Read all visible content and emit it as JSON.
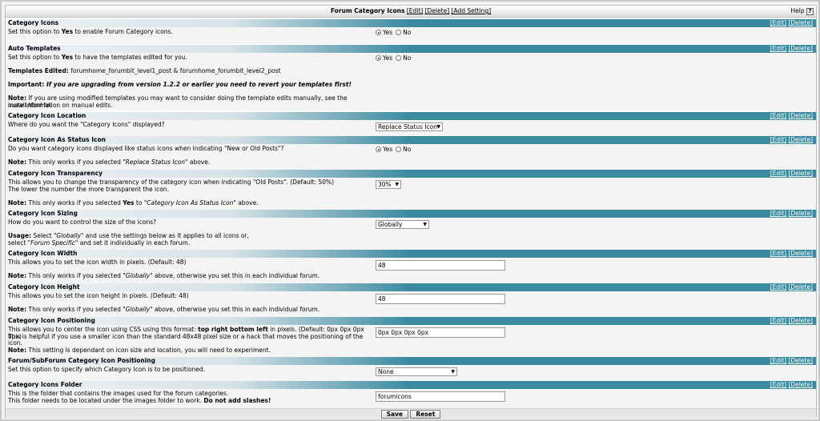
{
  "title": {
    "text": "Forum Category Icons",
    "edit": "[Edit]",
    "delete": "[Delete]",
    "add": "[Add Setting]",
    "help": "Help",
    "help_icon": "?"
  },
  "actions": {
    "edit": "[Edit]",
    "delete": "[Delete]"
  },
  "radio": {
    "yes": "Yes",
    "no": "No"
  },
  "sections": [
    {
      "title": "Category Icons",
      "lines": [
        "Set this option to <b>Yes</b> to enable Forum Category icons."
      ],
      "control": {
        "type": "radio",
        "selected": "yes"
      }
    },
    {
      "title": "Auto Templates",
      "lines": [
        "Set this option to <b>Yes</b> to have the templates edited for you.",
        "",
        "<b>Templates Edited:</b> forumhome_forumbit_level1_post &amp; forumhome_forumbit_level2_post",
        "",
        "<b>Important: <i>If you are upgrading from version 1.2.2 or earlier you need to revert your templates first!</i></b>",
        "",
        "<b>Note:</b> If you are using modified templates you may want to consider doing the template edits manually, see the <i>install.html</i> for",
        "more information on manual edits."
      ],
      "control": {
        "type": "radio",
        "selected": "yes"
      }
    },
    {
      "title": "Category Icon Location",
      "lines": [
        "Where do you want the \"Category Icons\" displayed?"
      ],
      "control": {
        "type": "select",
        "value": "Replace Status Icon",
        "width": 84
      }
    },
    {
      "title": "Category Icon As Status Icon",
      "lines": [
        "Do you want category icons displayed like status icons when indicating \"New or Old Posts\"?",
        "",
        "<b>Note:</b> This only works if you selected <i>\"Replace Status Icon\"</i> above."
      ],
      "control": {
        "type": "radio",
        "selected": "yes"
      }
    },
    {
      "title": "Category Icon Transparency",
      "lines": [
        "This allows you to change the transparency of the category icon when indicating \"Old Posts\". (Default: 50%)",
        "The lower the number the more transparent the icon.",
        "",
        "<b>Note:</b> This only works if you selected <b>Yes</b> to <i>\"Category Icon As Status Icon\"</i> above."
      ],
      "control": {
        "type": "select",
        "value": "30%",
        "width": 32
      }
    },
    {
      "title": "Category Icon Sizing",
      "lines": [
        "How do you want to control the size of the icons?",
        "",
        "<b>Usage:</b> Select <i>\"Globally\"</i> and use the settings below as it applies to all icons or,",
        "select <i>\"Forum Specific\"</i> and set it individually in each forum."
      ],
      "control": {
        "type": "select",
        "value": "Globally",
        "width": 67
      }
    },
    {
      "title": "Category Icon Width",
      "lines": [
        "This allows you to set the icon width in pixels. (Default: 48)",
        "",
        "<b>Note:</b> This only works if you selected <i>\"Globally\"</i> above, otherwise you set this in each individual forum."
      ],
      "control": {
        "type": "text",
        "value": "48"
      }
    },
    {
      "title": "Category Icon Height",
      "lines": [
        "This allows you to set the icon height in pixels. (Default: 48)",
        "",
        "<b>Note:</b> This only works if you selected <i>\"Globally\"</i> above, otherwise you set this in each individual forum."
      ],
      "control": {
        "type": "text",
        "value": "48"
      }
    },
    {
      "title": "Category Icon Positioning",
      "lines": [
        "This allows you to center the icon using CSS using this format: <b>top right bottom left</b> in pixels. (Default: 0px 0px 0px 0px)",
        "This is helpful if you use a smaller icon than the standard 48x48 pixel size or a hack that moves the positioning of the icon.",
        "",
        "<b>Note:</b> This setting is dependant on icon size and location, you will need to experiment."
      ],
      "control": {
        "type": "text",
        "value": "0px 0px 0px 0px"
      }
    },
    {
      "title": "Forum/SubForum Category Icon Positioning",
      "lines": [
        "Set this option to specify which Category Icon is to be positioned."
      ],
      "control": {
        "type": "select",
        "value": "None",
        "width": 102
      }
    },
    {
      "title": "Category Icons Folder",
      "lines": [
        "This is the folder that contains the images used for the forum categories.",
        "This folder needs to be located under the images folder to work. <b>Do not add slashes!</b>"
      ],
      "control": {
        "type": "text",
        "value": "forumicons"
      }
    }
  ],
  "footer": {
    "save": "Save",
    "reset": "Reset"
  }
}
